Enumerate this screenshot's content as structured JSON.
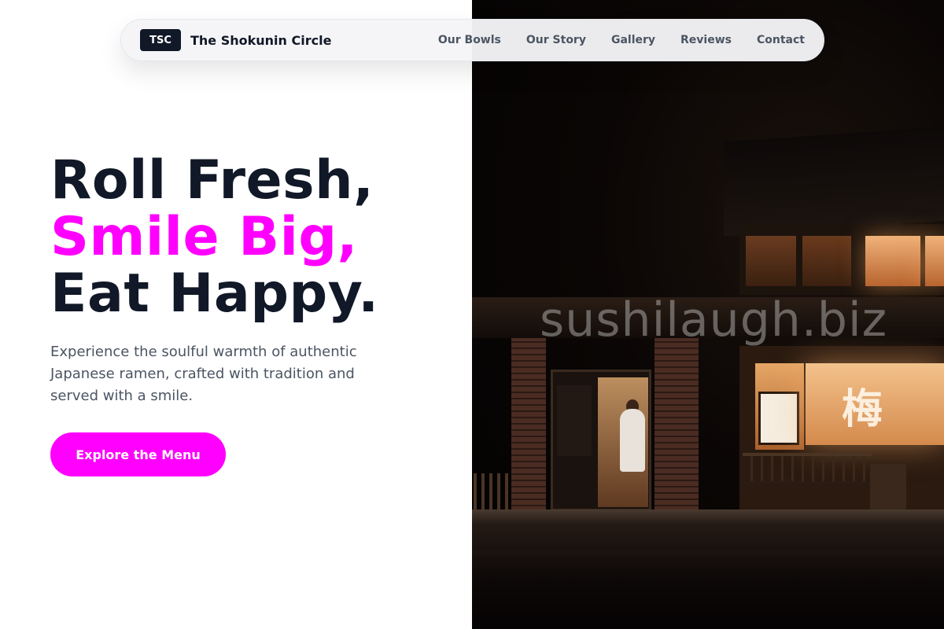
{
  "brand": {
    "logo_text": "TSC",
    "name": "The Shokunin Circle"
  },
  "nav": {
    "links": [
      "Our Bowls",
      "Our Story",
      "Gallery",
      "Reviews",
      "Contact"
    ]
  },
  "hero": {
    "title_line1": "Roll Fresh,",
    "title_line2": "Smile Big,",
    "title_line3": "Eat Happy.",
    "subtitle": "Experience the soulful warmth of authentic Japanese ramen, crafted with tradition and served with a smile.",
    "cta_label": "Explore the Menu"
  },
  "photo": {
    "watermark": "sushilaugh.biz",
    "sign_kanji": "梅"
  },
  "colors": {
    "accent": "#ff00ff",
    "heading": "#111827",
    "body_text": "#4b5563",
    "nav_bg": "#f5f5f7"
  }
}
